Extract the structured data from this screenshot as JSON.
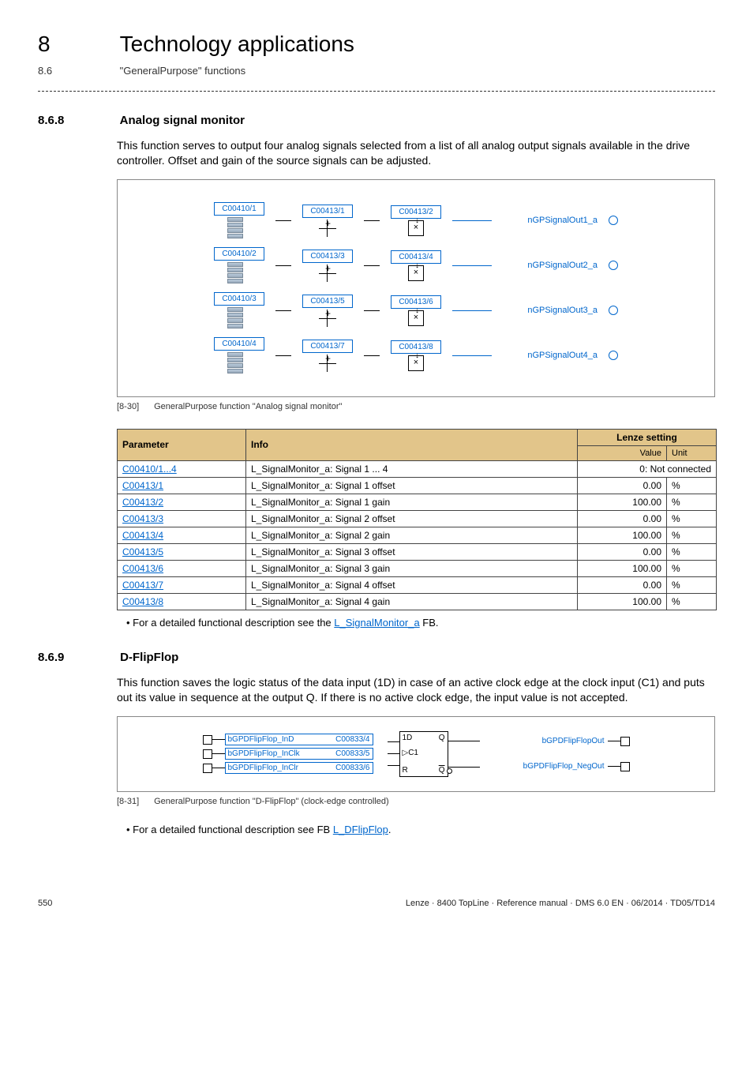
{
  "chapter": {
    "number": "8",
    "title": "Technology applications"
  },
  "subsection": {
    "number": "8.6",
    "title": "\"GeneralPurpose\" functions"
  },
  "sec1": {
    "number": "8.6.8",
    "title": "Analog signal monitor",
    "desc": "This function serves to output four analog signals selected from a list of all analog output signals available in the drive controller. Offset and gain of the source signals can be adjusted.",
    "fig_idx": "[8-30]",
    "fig_caption": "GeneralPurpose function \"Analog signal monitor\"",
    "rows": [
      {
        "sel": "C00410/1",
        "off": "C00413/1",
        "gain": "C00413/2",
        "out": "nGPSignalOut1_a"
      },
      {
        "sel": "C00410/2",
        "off": "C00413/3",
        "gain": "C00413/4",
        "out": "nGPSignalOut2_a"
      },
      {
        "sel": "C00410/3",
        "off": "C00413/5",
        "gain": "C00413/6",
        "out": "nGPSignalOut3_a"
      },
      {
        "sel": "C00410/4",
        "off": "C00413/7",
        "gain": "C00413/8",
        "out": "nGPSignalOut4_a"
      }
    ],
    "table": {
      "headers": {
        "param": "Parameter",
        "info": "Info",
        "lenze": "Lenze setting",
        "value": "Value",
        "unit": "Unit"
      },
      "rows": [
        {
          "p": "C00410/1...4",
          "info": "L_SignalMonitor_a: Signal 1 ... 4",
          "value": "0: Not connected",
          "unit": "",
          "span": true
        },
        {
          "p": "C00413/1",
          "info": "L_SignalMonitor_a: Signal 1 offset",
          "value": "0.00",
          "unit": "%"
        },
        {
          "p": "C00413/2",
          "info": "L_SignalMonitor_a: Signal 1 gain",
          "value": "100.00",
          "unit": "%"
        },
        {
          "p": "C00413/3",
          "info": "L_SignalMonitor_a: Signal 2 offset",
          "value": "0.00",
          "unit": "%"
        },
        {
          "p": "C00413/4",
          "info": "L_SignalMonitor_a: Signal 2 gain",
          "value": "100.00",
          "unit": "%"
        },
        {
          "p": "C00413/5",
          "info": "L_SignalMonitor_a: Signal 3 offset",
          "value": "0.00",
          "unit": "%"
        },
        {
          "p": "C00413/6",
          "info": "L_SignalMonitor_a: Signal 3 gain",
          "value": "100.00",
          "unit": "%"
        },
        {
          "p": "C00413/7",
          "info": "L_SignalMonitor_a: Signal 4 offset",
          "value": "0.00",
          "unit": "%"
        },
        {
          "p": "C00413/8",
          "info": "L_SignalMonitor_a: Signal 4 gain",
          "value": "100.00",
          "unit": "%"
        }
      ]
    },
    "footnote_pre": "For a detailed functional description see the ",
    "footnote_link": "L_SignalMonitor_a",
    "footnote_post": " FB."
  },
  "sec2": {
    "number": "8.6.9",
    "title": "D-FlipFlop",
    "desc": "This function saves the logic status of the data input (1D) in case of an active clock edge at the clock input (C1) and puts out its value in sequence at the output Q. If there is no active clock edge, the input value is not accepted.",
    "fig_idx": "[8-31]",
    "fig_caption": "GeneralPurpose function \"D-FlipFlop\" (clock-edge controlled)",
    "inputs": [
      {
        "name": "bGPDFlipFlop_InD",
        "code": "C00833/4"
      },
      {
        "name": "bGPDFlipFlop_InClk",
        "code": "C00833/5"
      },
      {
        "name": "bGPDFlipFlop_InClr",
        "code": "C00833/6"
      }
    ],
    "pins": {
      "d": "1D",
      "c": "C1",
      "r": "R",
      "q": "Q",
      "qn": "Q"
    },
    "outputs": [
      {
        "name": "bGPDFlipFlopOut"
      },
      {
        "name": "bGPDFlipFlop_NegOut"
      }
    ],
    "footnote_pre": "For a detailed functional description see FB ",
    "footnote_link": "L_DFlipFlop",
    "footnote_post": "."
  },
  "footer": {
    "page": "550",
    "meta": "Lenze · 8400 TopLine · Reference manual · DMS 6.0 EN · 06/2014 · TD05/TD14"
  }
}
